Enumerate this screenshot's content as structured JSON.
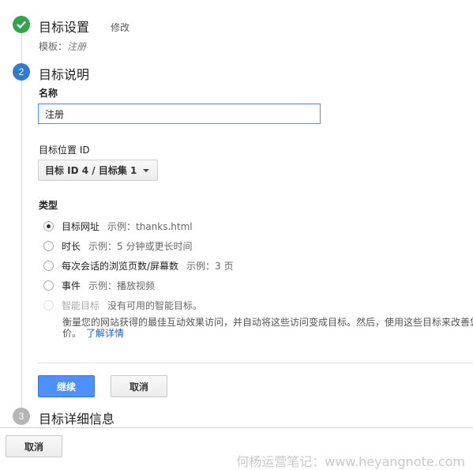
{
  "steps": {
    "step1": {
      "number": "",
      "title": "目标设置",
      "edit_label": "修改",
      "template_prefix": "模板：",
      "template_value": "注册"
    },
    "step2": {
      "number": "2",
      "title": "目标说明"
    },
    "step3": {
      "number": "3",
      "title": "目标详细信息"
    }
  },
  "form": {
    "name_label": "名称",
    "name_value": "注册",
    "slot_label": "目标位置 ID",
    "slot_value": "目标 ID 4 / 目标集 1",
    "type_label": "类型",
    "types": [
      {
        "label": "目标网址",
        "example": "示例：thanks.html",
        "selected": true
      },
      {
        "label": "时长",
        "example": "示例：5 分钟或更长时间",
        "selected": false
      },
      {
        "label": "每次会话的浏览页数/屏幕数",
        "example": "示例：3 页",
        "selected": false
      },
      {
        "label": "事件",
        "example": "示例：播放视频",
        "selected": false
      },
      {
        "label": "智能目标",
        "example": "没有可用的智能目标。",
        "selected": false,
        "disabled": true
      }
    ],
    "smart_desc_line1": "衡量您的网站获得的最佳互动效果访问，并自动将这些访问变成目标。然后，使用这些目标来改善您的广告系列的效果",
    "smart_desc_line2": "价。",
    "learn_more": "了解详情"
  },
  "buttons": {
    "continue": "继续",
    "cancel": "取消",
    "cancel_bottom": "取消"
  },
  "watermark": "何杨运营笔记：www.heyangnote.com",
  "colors": {
    "done": "#35a34a",
    "active": "#2e7bcf",
    "inactive": "#b5b5b5",
    "primary": "#4d90fe",
    "link": "#1a64b8"
  }
}
